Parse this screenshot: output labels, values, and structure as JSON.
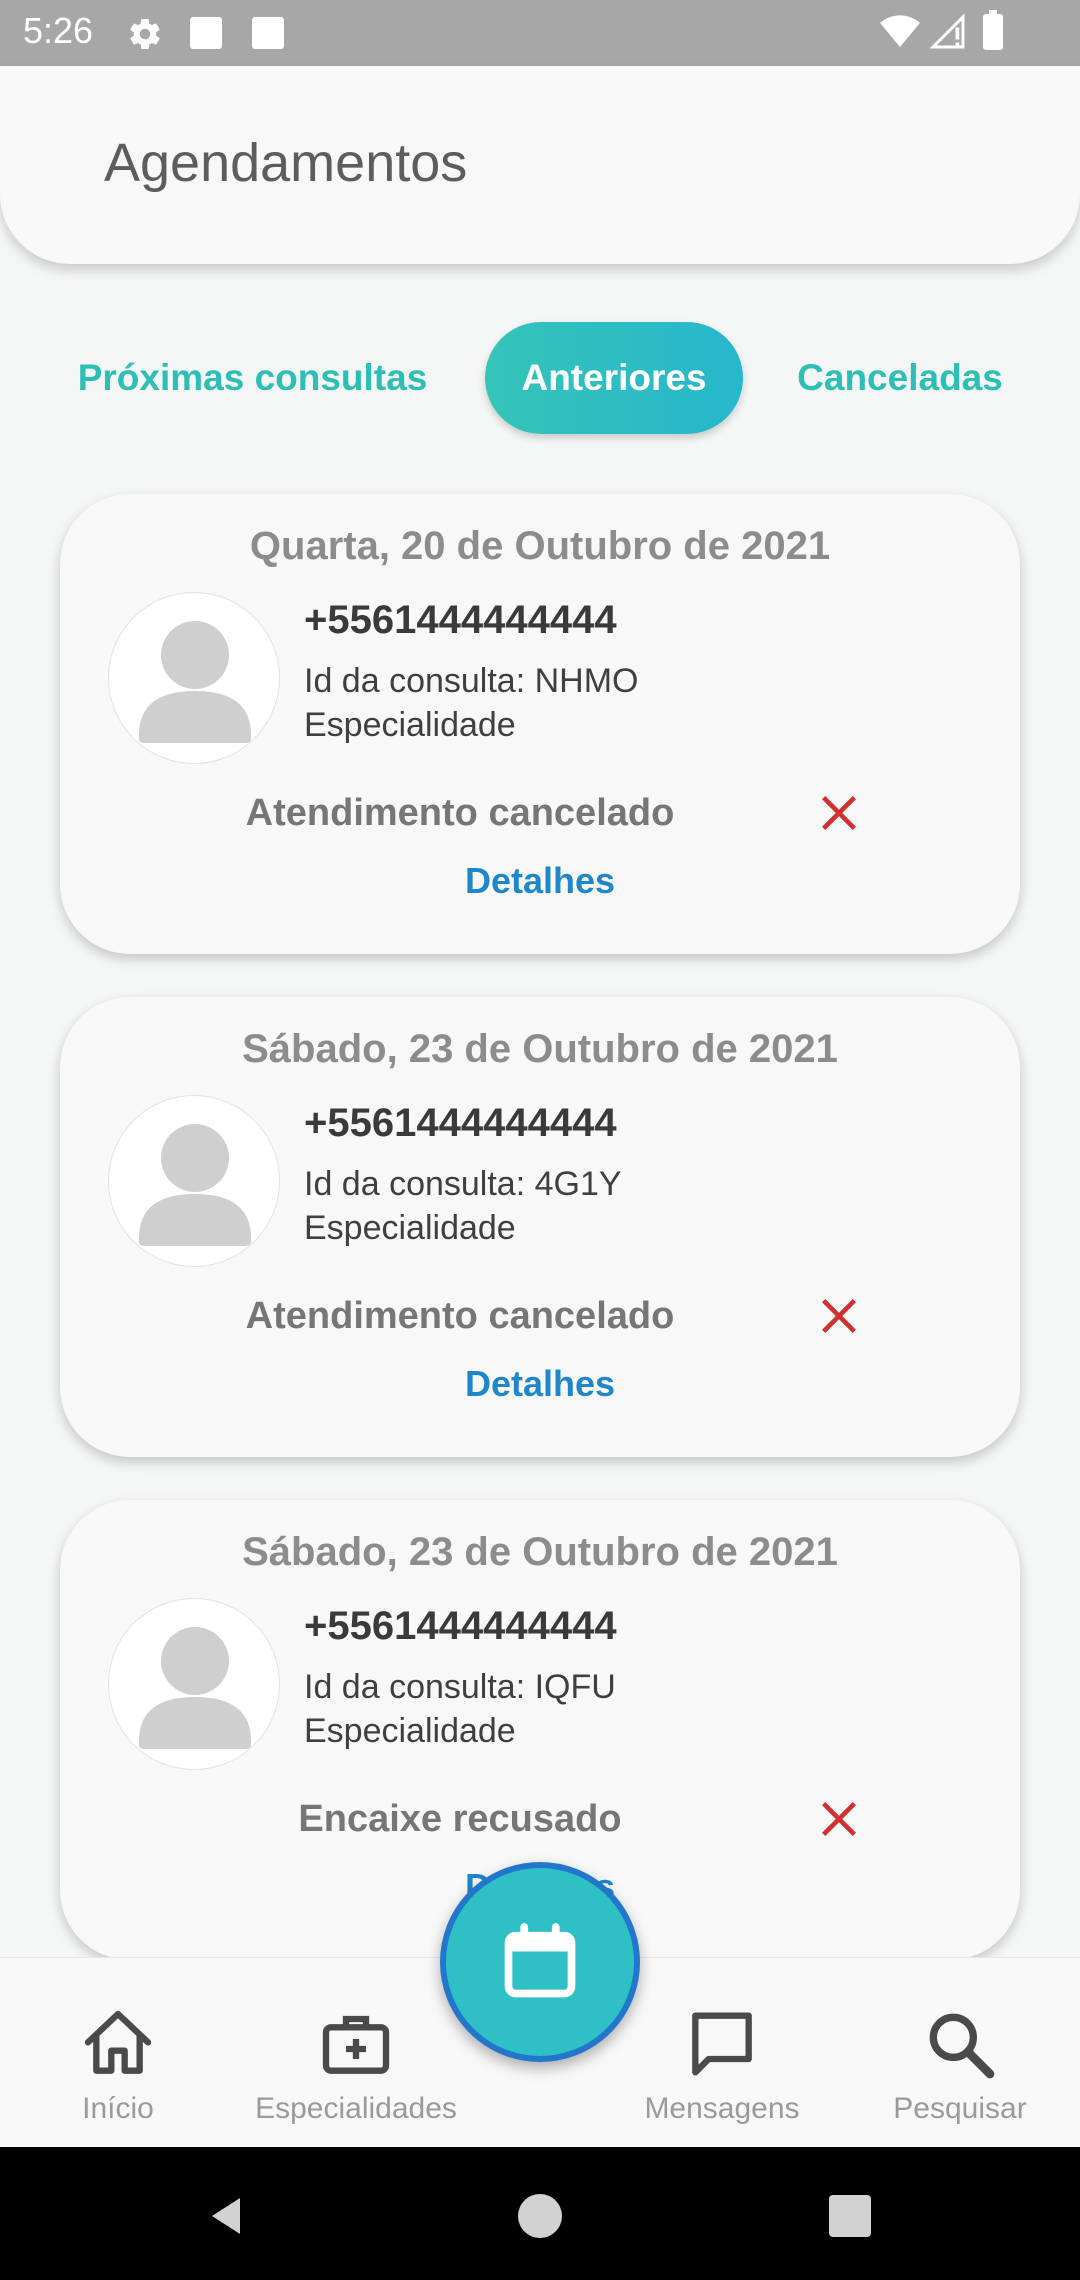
{
  "status_bar": {
    "time": "5:26",
    "icons": [
      "gear-icon",
      "notification-square-icon",
      "notification-square-icon",
      "wifi-icon",
      "signal-icon",
      "battery-icon"
    ]
  },
  "header": {
    "title": "Agendamentos"
  },
  "tabs": [
    {
      "label": "Próximas consultas",
      "active": false
    },
    {
      "label": "Anteriores",
      "active": true
    },
    {
      "label": "Canceladas",
      "active": false
    }
  ],
  "appointments": [
    {
      "date": "Quarta, 20 de Outubro de 2021",
      "phone": "+5561444444444",
      "id_line": "Id da consulta: NHMO",
      "specialty": "Especialidade",
      "status": "Atendimento cancelado",
      "details_label": "Detalhes"
    },
    {
      "date": "Sábado, 23 de Outubro de 2021",
      "phone": "+5561444444444",
      "id_line": "Id da consulta: 4G1Y",
      "specialty": "Especialidade",
      "status": "Atendimento cancelado",
      "details_label": "Detalhes"
    },
    {
      "date": "Sábado, 23 de Outubro de 2021",
      "phone": "+5561444444444",
      "id_line": "Id da consulta: IQFU",
      "specialty": "Especialidade",
      "status": "Encaixe recusado",
      "details_label": "Detalhes"
    }
  ],
  "bottom_nav": [
    {
      "label": "Início",
      "icon": "home-icon"
    },
    {
      "label": "Especialidades",
      "icon": "medical-kit-icon"
    },
    {
      "label": "Mensagens",
      "icon": "message-icon"
    },
    {
      "label": "Pesquisar",
      "icon": "search-icon"
    }
  ],
  "fab": {
    "icon": "calendar-icon"
  },
  "colors": {
    "accent": "#2bbfb5",
    "link": "#1f86cc",
    "cancel": "#d32f2f",
    "fab_border": "#2277cc"
  }
}
